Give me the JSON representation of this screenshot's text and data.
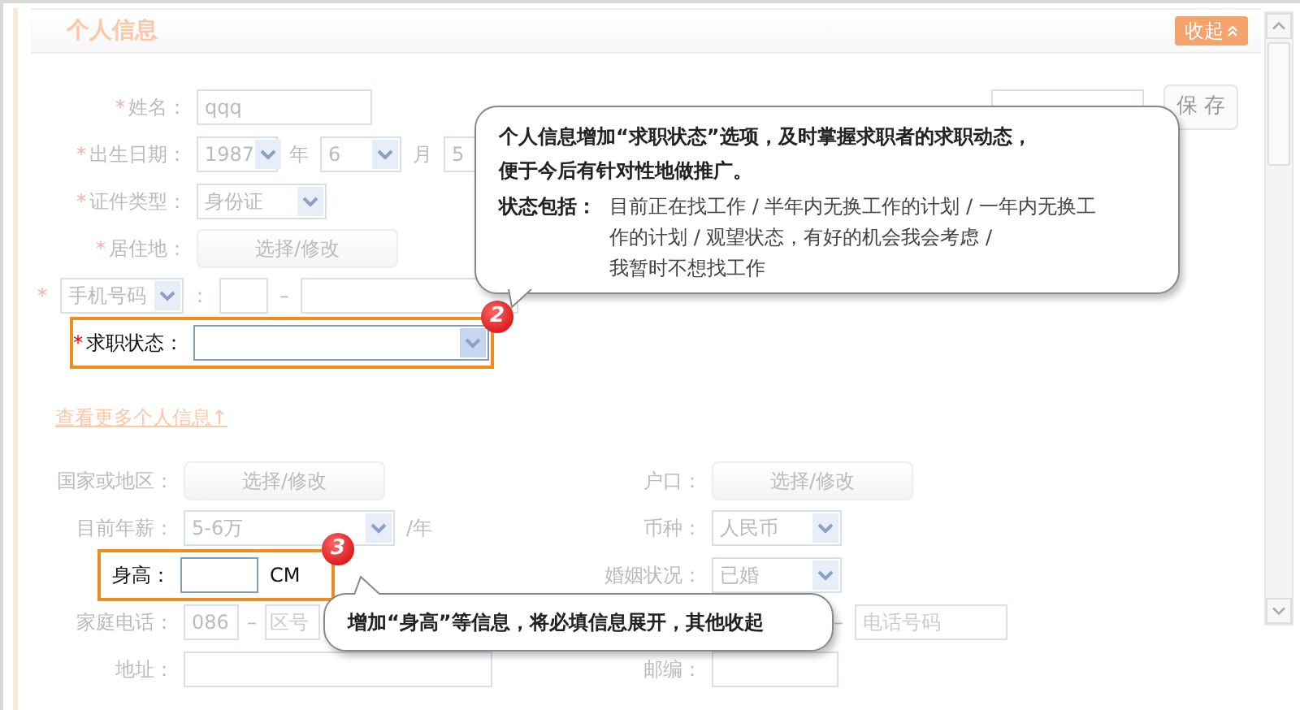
{
  "section": {
    "title": "个人信息",
    "collapse": "收起"
  },
  "required": [
    {
      "kind": "text",
      "mark": "*",
      "label": "姓名：",
      "value": "qqq"
    },
    {
      "kind": "date",
      "mark": "*",
      "label": "出生日期：",
      "parts": [
        {
          "value": "1987",
          "unit": "年"
        },
        {
          "value": "6",
          "unit": "月"
        },
        {
          "value": "5"
        }
      ]
    },
    {
      "kind": "select",
      "mark": "*",
      "label": "证件类型：",
      "value": "身份证"
    },
    {
      "kind": "picker",
      "mark": "*",
      "label": "居住地：",
      "button": "选择/修改"
    },
    {
      "kind": "phone",
      "mark": "*",
      "type": "手机号码",
      "colon": "：",
      "separator": "–"
    },
    {
      "kind": "select",
      "mark": "*",
      "label": "求职状态：",
      "highlighted": true,
      "badge": "2"
    }
  ],
  "side": {
    "save": "保 存"
  },
  "more_link": "查看更多个人信息↑",
  "optional": [
    {
      "left": {
        "kind": "picker",
        "label": "国家或地区：",
        "button": "选择/修改"
      },
      "right": {
        "kind": "picker",
        "label": "户口：",
        "button": "选择/修改"
      }
    },
    {
      "left": {
        "kind": "select",
        "label": "目前年薪：",
        "value": "5-6万",
        "unit": "/年"
      },
      "right": {
        "kind": "select",
        "label": "币种：",
        "value": "人民币"
      }
    },
    {
      "left": {
        "kind": "text",
        "label": "身高：",
        "unit": "CM",
        "highlighted": true,
        "badge": "3"
      },
      "right": {
        "kind": "select",
        "label": "婚姻状况：",
        "value": "已婚"
      }
    },
    {
      "left": {
        "kind": "homephone",
        "label": "家庭电话：",
        "value": "086",
        "separator": "–",
        "placeholder": "区号"
      },
      "right": {
        "kind": "number",
        "separator": "–",
        "placeholder": "电话号码"
      }
    },
    {
      "left": {
        "kind": "text",
        "label": "地址："
      },
      "right": {
        "kind": "text",
        "label": "邮编："
      }
    }
  ],
  "callouts": [
    {
      "kind": "status",
      "lines": [
        "个人信息增加“**求职状态**”选项，及时掌握求职者的求职动态，",
        "便于今后有针对性地做推广。"
      ],
      "list_label": "状态包括：",
      "list_lines": [
        "目前正在找工作 / 半年内无换工作的计划 / 一年内无换工",
        "作的计划 / 观望状态，有好的机会我会考虑 /",
        "我暂时不想找工作"
      ]
    },
    {
      "kind": "height",
      "text": "增加“**身高**”等信息，将必填信息展开，其他收起"
    }
  ]
}
